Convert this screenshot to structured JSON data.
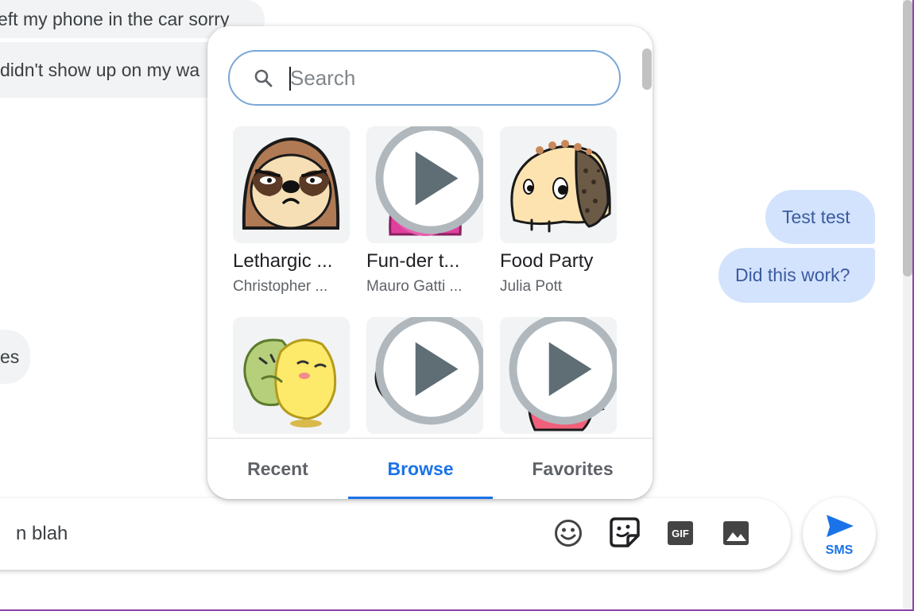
{
  "conversation": {
    "incoming_messages": [
      {
        "text": "eft my phone in the car sorry"
      },
      {
        "text": "didn't show up on my wa"
      },
      {
        "text": "es"
      }
    ],
    "outgoing_messages": [
      {
        "text": "Test test"
      },
      {
        "text": "Did this work?"
      }
    ]
  },
  "composer": {
    "draft_text": "n blah",
    "tools": [
      "emoji-icon",
      "sticker-icon",
      "gif-icon",
      "image-icon"
    ],
    "send_label": "SMS"
  },
  "sticker_picker": {
    "search": {
      "placeholder": "Search",
      "value": ""
    },
    "packs": [
      {
        "title": "Lethargic ...",
        "author": "Christopher ...",
        "icon": "sloth-sticker",
        "animated": false
      },
      {
        "title": "Fun-der t...",
        "author": "Mauro Gatti ...",
        "icon": "octopus-star-sticker",
        "animated": true
      },
      {
        "title": "Food Party",
        "author": "Julia Pott",
        "icon": "taco-sticker",
        "animated": false
      },
      {
        "title": "",
        "author": "",
        "icon": "hugging-friends-sticker",
        "animated": false
      },
      {
        "title": "",
        "author": "",
        "icon": "bun-face-sticker",
        "animated": true
      },
      {
        "title": "",
        "author": "",
        "icon": "dinosaur-sticker",
        "animated": true
      }
    ],
    "tabs": [
      {
        "label": "Recent",
        "active": false
      },
      {
        "label": "Browse",
        "active": true
      },
      {
        "label": "Favorites",
        "active": false
      }
    ]
  },
  "colors": {
    "accent": "#1a73e8",
    "outgoing_bubble": "#d3e3fd",
    "incoming_bubble": "#f1f3f4"
  }
}
